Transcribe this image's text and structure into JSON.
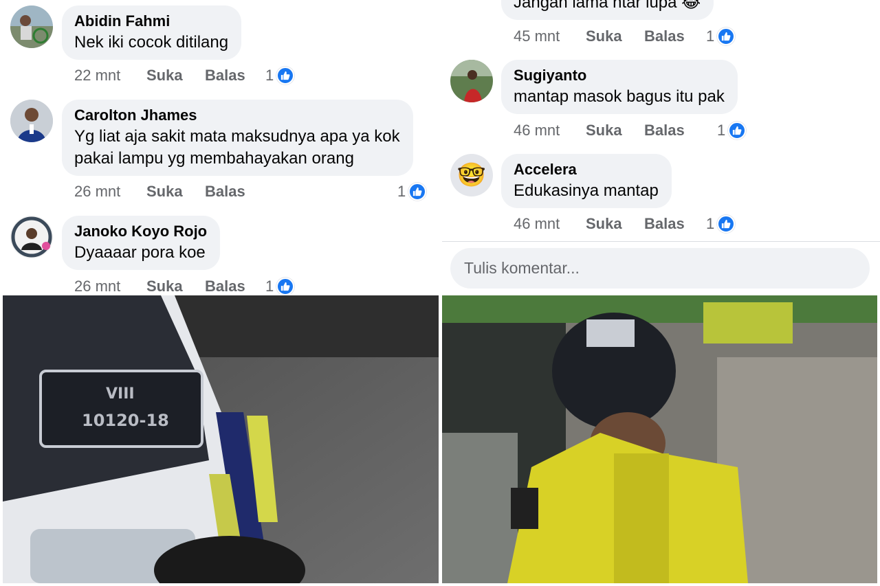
{
  "left_thread": {
    "comments": [
      {
        "author": "Abidin Fahmi",
        "text": "Nek iki cocok ditilang",
        "time": "22 mnt",
        "like": "Suka",
        "reply": "Balas",
        "reactions": "1"
      },
      {
        "author": "Carolton Jhames",
        "text_lines": [
          "Yg liat aja sakit mata maksudnya apa ya kok",
          "pakai lampu yg membahayakan orang"
        ],
        "time": "26 mnt",
        "like": "Suka",
        "reply": "Balas",
        "reactions": "1"
      },
      {
        "author": "Janoko Koyo Rojo",
        "text": "Dyaaaar pora koe",
        "time": "26 mnt",
        "like": "Suka",
        "reply": "Balas",
        "reactions": "1"
      }
    ]
  },
  "right_thread": {
    "partial_comment": {
      "text": "Jangan lama  ntar lupa 😂",
      "time": "45 mnt",
      "like": "Suka",
      "reply": "Balas",
      "reactions": "1"
    },
    "comments": [
      {
        "author": "Sugiyanto",
        "text": "mantap masok bagus itu pak",
        "time": "46 mnt",
        "like": "Suka",
        "reply": "Balas",
        "reactions": "1"
      },
      {
        "author": "Accelera",
        "text": "Edukasinya mantap",
        "time": "46 mnt",
        "like": "Suka",
        "reply": "Balas",
        "reactions": "1",
        "avatar_emoji": "🤓"
      }
    ],
    "composer": {
      "placeholder": "Tulis komentar..."
    }
  },
  "photos": {
    "left_plate_lines": [
      "VIII",
      "10120-18"
    ]
  },
  "colors": {
    "bubble": "#f0f2f5",
    "meta_text": "#65676b",
    "like_blue": "#1877f2",
    "divider": "#dadde1"
  },
  "icons": {
    "like_badge": "thumbs-up-icon"
  }
}
